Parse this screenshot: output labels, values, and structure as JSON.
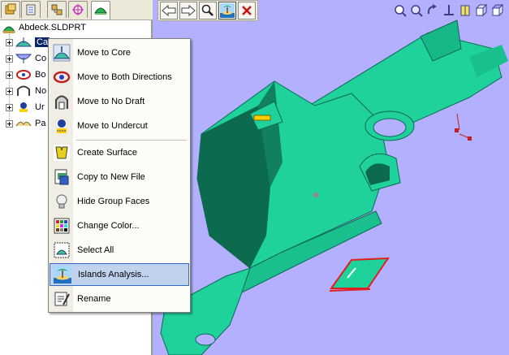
{
  "tree": {
    "root_label": "Abdeck.SLDPRT",
    "items": [
      {
        "label": "Ca",
        "selected": true
      },
      {
        "label": "Co"
      },
      {
        "label": "Bo"
      },
      {
        "label": "No"
      },
      {
        "label": "Ur"
      },
      {
        "label": "Pa"
      }
    ]
  },
  "panel_tabs": [
    "feature-manager-icon",
    "property-icon",
    "configuration-icon",
    "target-icon",
    "mold-tools-icon"
  ],
  "toolbar": {
    "buttons": [
      "arrow-left-icon",
      "arrow-right-icon",
      "zoom-select-icon",
      "islands-icon",
      "close-icon"
    ]
  },
  "view_toolbar": [
    "zoom-fit-icon",
    "zoom-area-icon",
    "rotate-icon",
    "move-icon",
    "section-icon",
    "box-icon",
    "view-orientation-icon"
  ],
  "context_menu": {
    "items": [
      {
        "label": "Move to Core",
        "icon": "core-icon"
      },
      {
        "label": "Move to Both Directions",
        "icon": "both-directions-icon"
      },
      {
        "label": "Move to No Draft",
        "icon": "no-draft-icon"
      },
      {
        "label": "Move to Undercut",
        "icon": "undercut-icon"
      },
      {
        "label": "Create Surface",
        "icon": "create-surface-icon"
      },
      {
        "label": "Copy to New File",
        "icon": "copy-file-icon"
      },
      {
        "label": "Hide Group Faces",
        "icon": "hide-faces-icon"
      },
      {
        "label": "Change Color...",
        "icon": "palette-icon"
      },
      {
        "label": "Select All",
        "icon": "select-all-icon"
      },
      {
        "label": "Islands Analysis...",
        "icon": "islands-icon",
        "highlighted": true
      },
      {
        "label": "Rename",
        "icon": "rename-icon"
      }
    ]
  },
  "colors": {
    "viewport_bg": "#b3b0ff",
    "part_face": "#1fd19a",
    "part_shadow": "#0c6a4f",
    "highlight": "#c1d2ee",
    "selection": "#0a246a"
  }
}
